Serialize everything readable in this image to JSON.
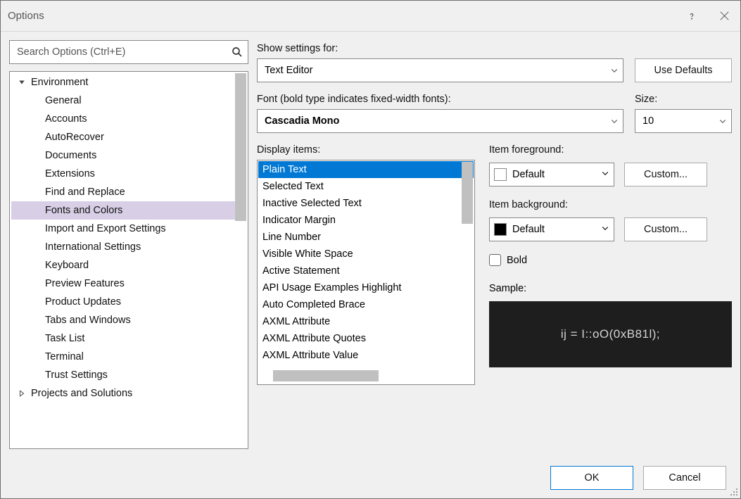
{
  "title": "Options",
  "search": {
    "placeholder": "Search Options (Ctrl+E)"
  },
  "tree": {
    "nodes": [
      {
        "label": "Environment",
        "level": 0,
        "expanded": true
      },
      {
        "label": "General",
        "level": 1
      },
      {
        "label": "Accounts",
        "level": 1
      },
      {
        "label": "AutoRecover",
        "level": 1
      },
      {
        "label": "Documents",
        "level": 1
      },
      {
        "label": "Extensions",
        "level": 1
      },
      {
        "label": "Find and Replace",
        "level": 1
      },
      {
        "label": "Fonts and Colors",
        "level": 1,
        "selected": true
      },
      {
        "label": "Import and Export Settings",
        "level": 1
      },
      {
        "label": "International Settings",
        "level": 1
      },
      {
        "label": "Keyboard",
        "level": 1
      },
      {
        "label": "Preview Features",
        "level": 1
      },
      {
        "label": "Product Updates",
        "level": 1
      },
      {
        "label": "Tabs and Windows",
        "level": 1
      },
      {
        "label": "Task List",
        "level": 1
      },
      {
        "label": "Terminal",
        "level": 1
      },
      {
        "label": "Trust Settings",
        "level": 1
      },
      {
        "label": "Projects and Solutions",
        "level": 0,
        "expanded": false
      }
    ]
  },
  "settings": {
    "show_settings_for_label": "Show settings for:",
    "show_settings_for_value": "Text Editor",
    "use_defaults_label": "Use Defaults",
    "font_label": "Font (bold type indicates fixed-width fonts):",
    "font_value": "Cascadia Mono",
    "size_label": "Size:",
    "size_value": "10",
    "display_items_label": "Display items:",
    "display_items": [
      "Plain Text",
      "Selected Text",
      "Inactive Selected Text",
      "Indicator Margin",
      "Line Number",
      "Visible White Space",
      "Active Statement",
      "API Usage Examples Highlight",
      "Auto Completed Brace",
      "AXML Attribute",
      "AXML Attribute Quotes",
      "AXML Attribute Value"
    ],
    "display_selected_index": 0,
    "item_fg_label": "Item foreground:",
    "item_fg_value": "Default",
    "item_bg_label": "Item background:",
    "item_bg_value": "Default",
    "custom_label": "Custom...",
    "bold_label": "Bold",
    "bold_checked": false,
    "sample_label": "Sample:",
    "sample_text": "ij = I::oO(0xB81l);"
  },
  "buttons": {
    "ok": "OK",
    "cancel": "Cancel"
  },
  "colors": {
    "selection_blue": "#0078d4",
    "tree_selection": "#d8cfe6",
    "sample_bg": "#1e1e1e"
  }
}
